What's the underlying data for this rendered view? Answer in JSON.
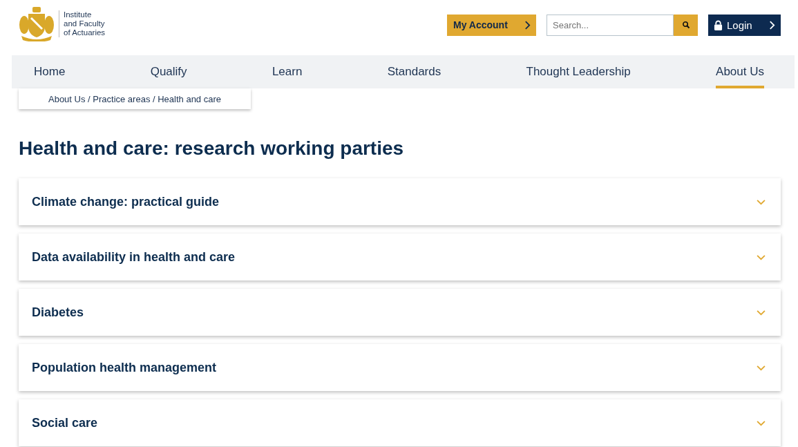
{
  "logo": {
    "lines": [
      "Institute",
      "and Faculty",
      "of Actuaries"
    ]
  },
  "header": {
    "account_button": "My Account",
    "search": {
      "placeholder": "Search..."
    },
    "login_button": "Login"
  },
  "nav": [
    {
      "label": "Home",
      "selected": false
    },
    {
      "label": "Qualify",
      "selected": false
    },
    {
      "label": "Learn",
      "selected": false
    },
    {
      "label": "Standards",
      "selected": false
    },
    {
      "label": "Thought Leadership",
      "selected": false
    },
    {
      "label": "About Us",
      "selected": true
    }
  ],
  "breadcrumb": "About Us / Practice areas / Health and care",
  "heading": "Health and care: research working parties",
  "accordion": [
    {
      "title": "Climate change: practical guide",
      "expanded": false
    },
    {
      "title": "Data availability in health and care",
      "expanded": false
    },
    {
      "title": "Diabetes",
      "expanded": false
    },
    {
      "title": "Population health management",
      "expanded": false
    },
    {
      "title": "Social care",
      "expanded": false
    }
  ]
}
